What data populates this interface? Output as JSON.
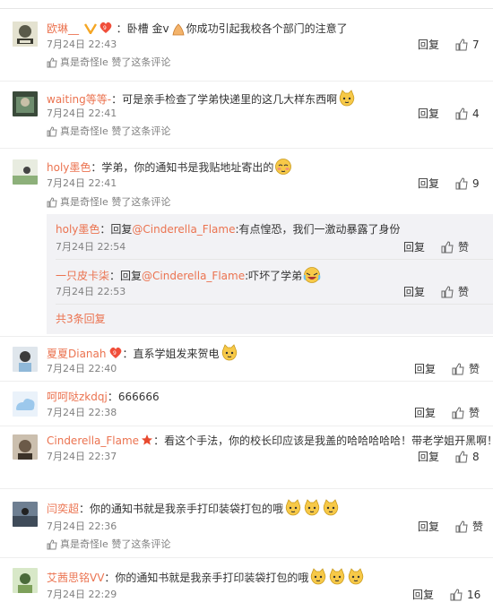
{
  "actions": {
    "reply_label": "回复",
    "like_label": "赞"
  },
  "liker_text": "真是奇怪le 赞了这条评论",
  "comments": [
    {
      "user": "欧琳__",
      "text": "：卧槽 金v",
      "text2": "你成功引起我校各个部门的注意了",
      "time": "7月24日 22:43",
      "likes": "7"
    },
    {
      "user": "waiting等等-",
      "text": "：可是亲手检查了学弟快递里的这几大样东西啊",
      "time": "7月24日 22:41",
      "likes": "4"
    },
    {
      "user": "holy墨色",
      "text": "：学弟，你的通知书是我贴地址寄出的",
      "time": "7月24日 22:41",
      "likes": "9"
    },
    {
      "user": "夏夏Dianah",
      "text": "：直系学姐发来贺电",
      "time": "7月24日 22:40",
      "likes": ""
    },
    {
      "user": "呵呵哒zkdqj",
      "text": "：666666",
      "time": "7月24日 22:38",
      "likes": ""
    },
    {
      "user": "Cinderella_Flame",
      "text": "：看这个手法，你的校长印应该是我盖的哈哈哈哈哈！带老学姐开黑啊！",
      "time": "7月24日 22:37",
      "likes": "8"
    },
    {
      "user": "闫奕超",
      "text": "：你的通知书就是我亲手打印装袋打包的哦",
      "time": "7月24日 22:36",
      "likes": ""
    },
    {
      "user": "艾茜思铭VV",
      "text": "：你的通知书就是我亲手打印装袋打包的哦",
      "time": "7月24日 22:29",
      "likes": "16"
    }
  ],
  "replies": [
    {
      "user": "holy墨色",
      "prefix": "：回复",
      "mention": "@Cinderella_Flame",
      "text": ":有点惶恐，我们一激动暴露了身份",
      "time": "7月24日 22:54"
    },
    {
      "user": "一只皮卡柒",
      "prefix": "：回复",
      "mention": "@Cinderella_Flame",
      "text": ":吓坏了学弟",
      "time": "7月24日 22:53"
    }
  ],
  "more_replies": "共3条回复",
  "colors": {
    "username": "#eb7350",
    "time": "#808080",
    "subbox": "#f2f2f5"
  }
}
